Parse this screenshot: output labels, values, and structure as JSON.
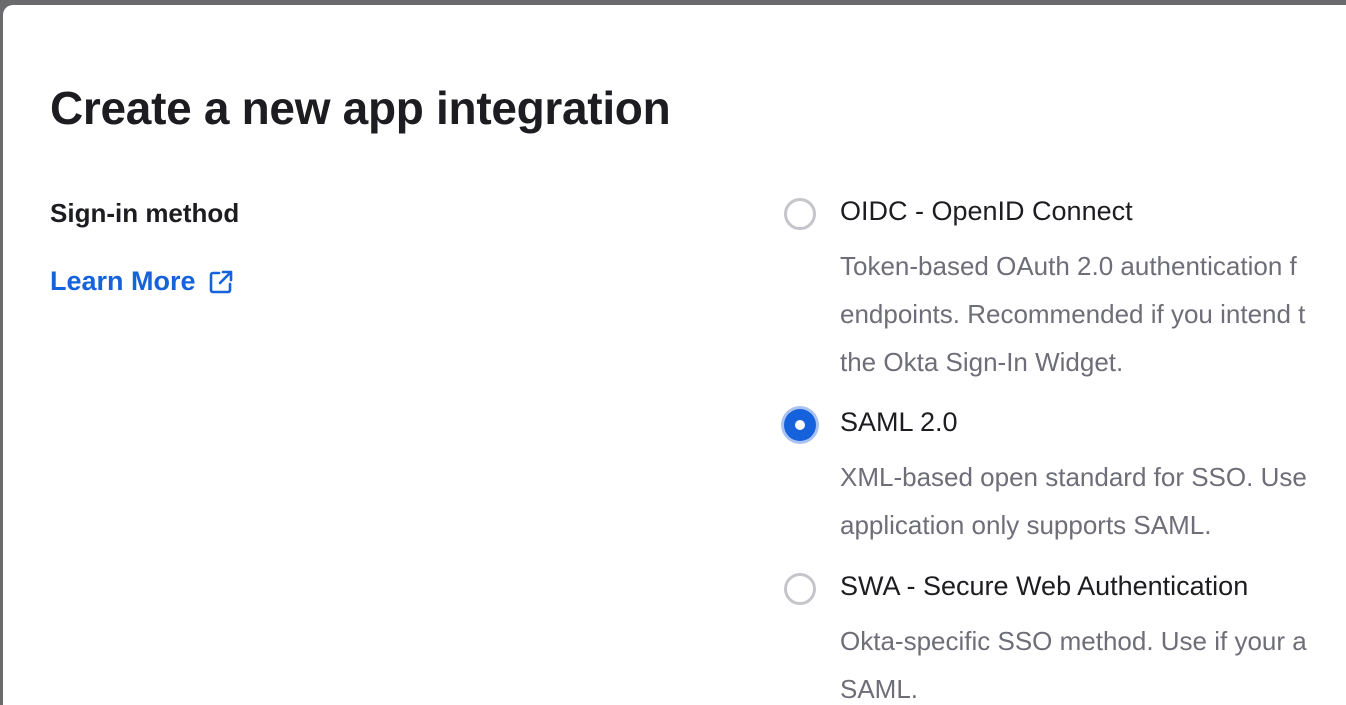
{
  "dialog": {
    "title": "Create a new app integration",
    "section_label": "Sign-in method",
    "learn_more_label": "Learn More",
    "learn_more_icon": "external-link-icon",
    "accent_color": "#1662dd",
    "options": [
      {
        "label": "OIDC - OpenID Connect",
        "selected": false,
        "description_lines": [
          "Token-based OAuth 2.0 authentication f",
          "endpoints. Recommended if you intend t",
          "the Okta Sign-In Widget."
        ]
      },
      {
        "label": "SAML 2.0",
        "selected": true,
        "description_lines": [
          "XML-based open standard for SSO. Use",
          "application only supports SAML."
        ]
      },
      {
        "label": "SWA - Secure Web Authentication",
        "selected": false,
        "description_lines": [
          "Okta-specific SSO method. Use if your a",
          "SAML."
        ]
      }
    ]
  }
}
